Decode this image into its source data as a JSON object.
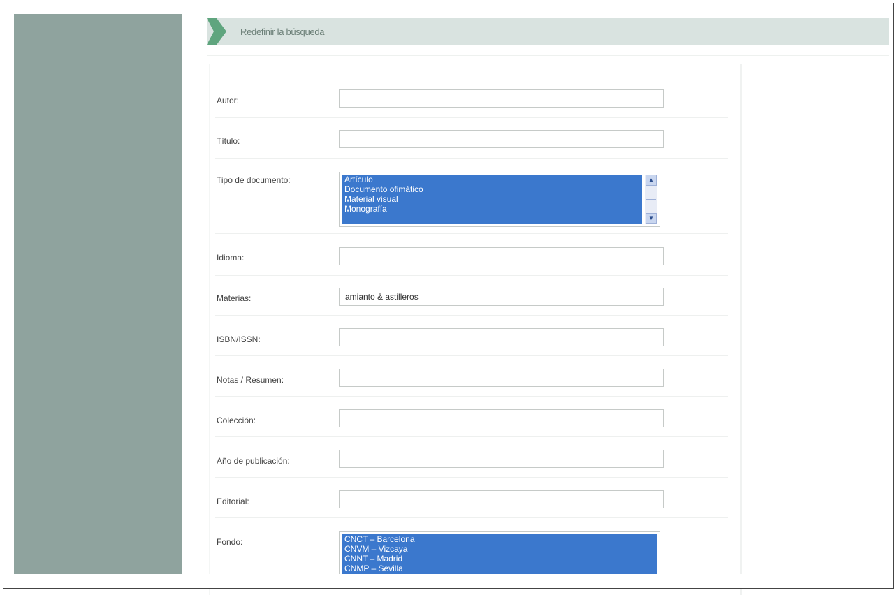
{
  "header": {
    "title": "Redefinir la búsqueda"
  },
  "form": {
    "autor": {
      "label": "Autor:",
      "value": ""
    },
    "titulo": {
      "label": "Título:",
      "value": ""
    },
    "tipo_documento": {
      "label": "Tipo de documento:",
      "options": [
        "Artículo",
        "Documento ofimático",
        "Material visual",
        "Monografía"
      ]
    },
    "idioma": {
      "label": "Idioma:",
      "value": ""
    },
    "materias": {
      "label": "Materias:",
      "value": "amianto & astilleros"
    },
    "isbn_issn": {
      "label": "ISBN/ISSN:",
      "value": ""
    },
    "notas_resumen": {
      "label": "Notas / Resumen:",
      "value": ""
    },
    "coleccion": {
      "label": "Colección:",
      "value": ""
    },
    "anio_publicacion": {
      "label": "Año de publicación:",
      "value": ""
    },
    "editorial": {
      "label": "Editorial:",
      "value": ""
    },
    "fondo": {
      "label": "Fondo:",
      "options": [
        "CNCT – Barcelona",
        "CNVM – Vizcaya",
        "CNNT – Madrid",
        "CNMP – Sevilla"
      ]
    }
  },
  "colors": {
    "sidebar": "#8fa39e",
    "header_bg": "#d9e3e0",
    "header_arrow": "#5fa57e",
    "selection": "#3b78cd"
  }
}
